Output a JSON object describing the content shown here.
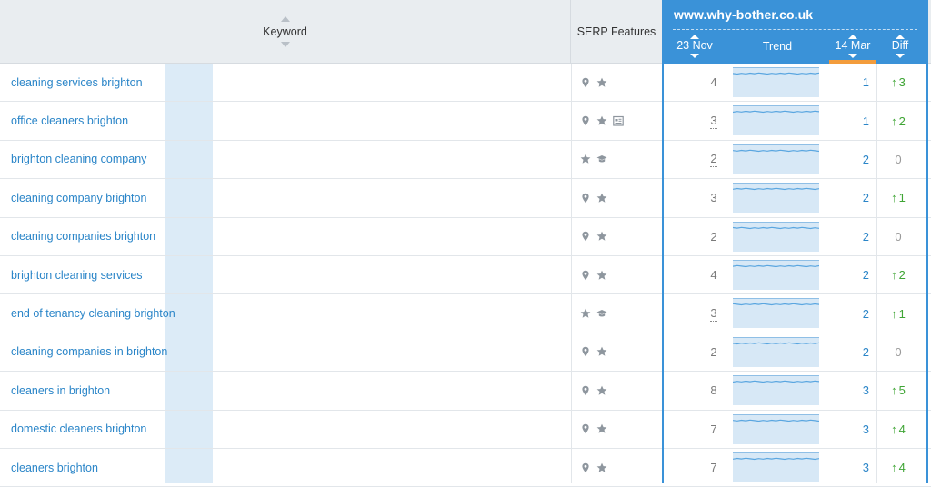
{
  "header": {
    "keyword_label": "Keyword",
    "serp_label": "SERP Features",
    "domain": "www.why-bother.co.uk",
    "date1": "23 Nov",
    "trend": "Trend",
    "date2": "14 Mar",
    "diff": "Diff"
  },
  "colors": {
    "accent": "#3a92d8",
    "link": "#2a85c8",
    "up": "#3fa535",
    "highlight": "#dcebf7",
    "orange": "#f39c3c"
  },
  "rows": [
    {
      "keyword": "cleaning services brighton",
      "features": [
        "pin-icon",
        "star-icon"
      ],
      "prev": "4",
      "prev_dotted": false,
      "curr": "1",
      "diff": "3",
      "diff_dir": "up"
    },
    {
      "keyword": "office cleaners brighton",
      "features": [
        "pin-icon",
        "star-icon",
        "news-icon"
      ],
      "prev": "3",
      "prev_dotted": true,
      "curr": "1",
      "diff": "2",
      "diff_dir": "up"
    },
    {
      "keyword": "brighton cleaning company",
      "features": [
        "star-icon",
        "graduation-cap-icon"
      ],
      "prev": "2",
      "prev_dotted": true,
      "curr": "2",
      "diff": "0",
      "diff_dir": "none"
    },
    {
      "keyword": "cleaning company brighton",
      "features": [
        "pin-icon",
        "star-icon"
      ],
      "prev": "3",
      "prev_dotted": false,
      "curr": "2",
      "diff": "1",
      "diff_dir": "up"
    },
    {
      "keyword": "cleaning companies brighton",
      "features": [
        "pin-icon",
        "star-icon"
      ],
      "prev": "2",
      "prev_dotted": false,
      "curr": "2",
      "diff": "0",
      "diff_dir": "none"
    },
    {
      "keyword": "brighton cleaning services",
      "features": [
        "pin-icon",
        "star-icon"
      ],
      "prev": "4",
      "prev_dotted": false,
      "curr": "2",
      "diff": "2",
      "diff_dir": "up"
    },
    {
      "keyword": "end of tenancy cleaning brighton",
      "features": [
        "star-icon",
        "graduation-cap-icon"
      ],
      "prev": "3",
      "prev_dotted": true,
      "curr": "2",
      "diff": "1",
      "diff_dir": "up"
    },
    {
      "keyword": "cleaning companies in brighton",
      "features": [
        "pin-icon",
        "star-icon"
      ],
      "prev": "2",
      "prev_dotted": false,
      "curr": "2",
      "diff": "0",
      "diff_dir": "none"
    },
    {
      "keyword": "cleaners in brighton",
      "features": [
        "pin-icon",
        "star-icon"
      ],
      "prev": "8",
      "prev_dotted": false,
      "curr": "3",
      "diff": "5",
      "diff_dir": "up"
    },
    {
      "keyword": "domestic cleaners brighton",
      "features": [
        "pin-icon",
        "star-icon"
      ],
      "prev": "7",
      "prev_dotted": false,
      "curr": "3",
      "diff": "4",
      "diff_dir": "up"
    },
    {
      "keyword": "cleaners brighton",
      "features": [
        "pin-icon",
        "star-icon"
      ],
      "prev": "7",
      "prev_dotted": false,
      "curr": "3",
      "diff": "4",
      "diff_dir": "up"
    }
  ]
}
